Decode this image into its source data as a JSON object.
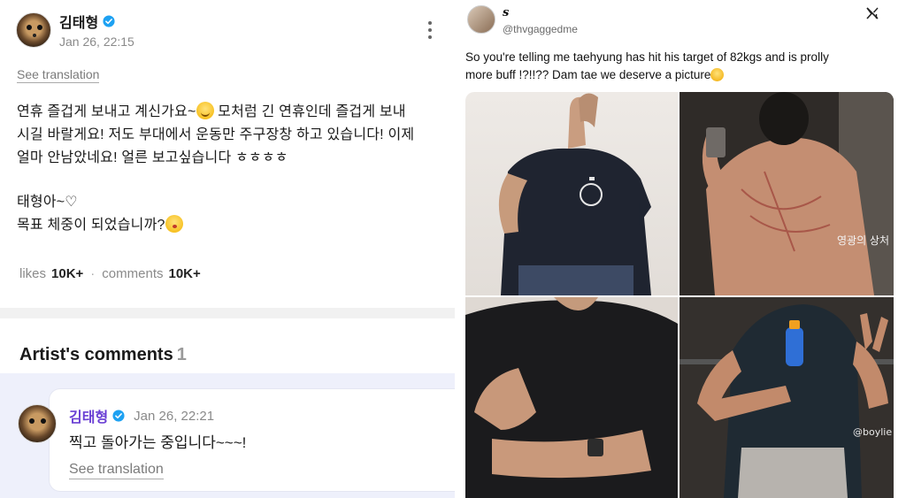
{
  "left_post": {
    "author": "김태형",
    "date": "Jan 26, 22:15",
    "see_translation": "See translation",
    "text_line1": "연휴 즐겁게 보내고 계신가요~",
    "text_line1b": " 모처럼 긴 연휴인데 즐겁게 보내",
    "text_line2": "시길 바랄게요! 저도 부대에서 운동만 주구장창 하고 있습니다! 이제",
    "text_line3": "얼마 안남았네요! 얼른 보고싶습니다 ㅎㅎㅎㅎ",
    "text_line4": "태형아~♡",
    "text_line5": "목표 체중이 되었습니까?",
    "likes_label": "likes",
    "likes_value": "10K+",
    "separator": "·",
    "comments_label": "comments",
    "comments_value": "10K+"
  },
  "artist_comments": {
    "title": "Artist's comments",
    "count": "1",
    "comment": {
      "author": "김태형",
      "date": "Jan 26, 22:21",
      "text": "찍고 돌아가는 중입니다~~~!",
      "see_translation": "See translation"
    }
  },
  "tweet": {
    "display_name": "s",
    "handle": "@thvgaggedme",
    "text_line1": "So you're telling me taehyung has hit his target of 82kgs and is prolly",
    "text_line2": "more buff  !?!!?? Dam tae we deserve a picture",
    "overlay_text_photo2": "영광의 상처",
    "overlay_text_photo4": "@boylie"
  },
  "colors": {
    "verified": "#1da1f2",
    "comment_author": "#6a3fd4",
    "comment_band": "#eef0fb"
  }
}
